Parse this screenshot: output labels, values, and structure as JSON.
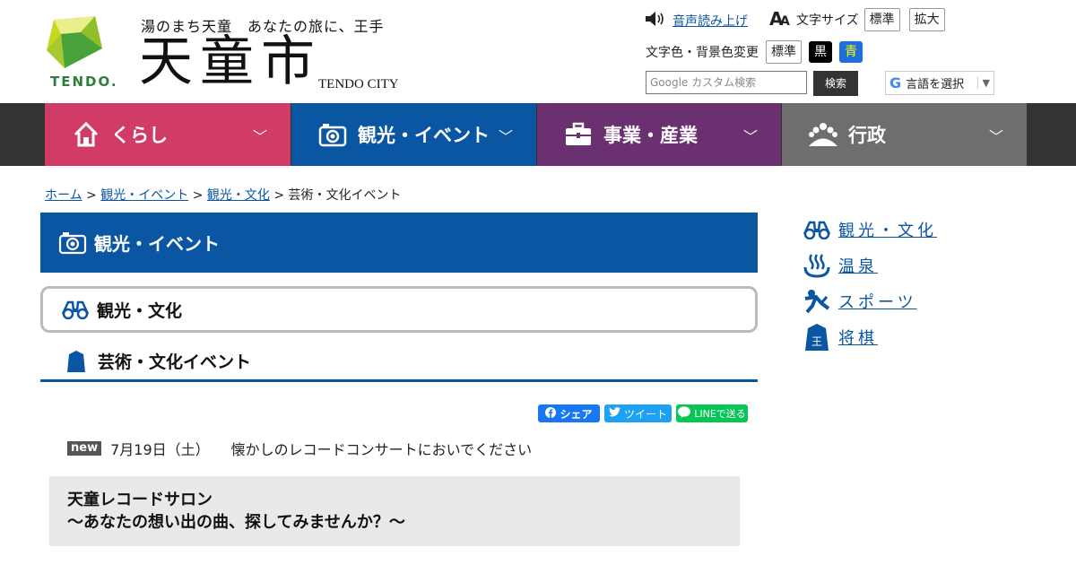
{
  "header": {
    "tagline": "湯のまち天童　あなたの旅に、王手",
    "city_name": "天童市",
    "city_name_en": "TENDO CITY",
    "logo_text": "TENDO.",
    "speech_label": "音声読み上げ",
    "font_size_label": "文字サイズ",
    "font_size_options": [
      "標準",
      "拡大"
    ],
    "color_label": "文字色・背景色変更",
    "color_options": [
      "標準",
      "黒",
      "青"
    ],
    "search_placeholder": "Google カスタム検索",
    "search_button": "検索",
    "language_label": "言語を選択",
    "language_arrow": "▼"
  },
  "nav": {
    "items": [
      {
        "label": "くらし",
        "icon": "house-icon",
        "color": "#d13c66"
      },
      {
        "label": "観光・イベント",
        "icon": "camera-icon",
        "color": "#0a56a3"
      },
      {
        "label": "事業・産業",
        "icon": "briefcase-icon",
        "color": "#6a3070"
      },
      {
        "label": "行政",
        "icon": "people-icon",
        "color": "#6e6e6e"
      }
    ],
    "chevron": "﹀"
  },
  "breadcrumb": {
    "items": [
      "ホーム",
      "観光・イベント",
      "観光・文化",
      "芸術・文化イベント"
    ],
    "separator": ">"
  },
  "section": {
    "title": "観光・イベント",
    "sub_title": "観光・文化",
    "page_title": "芸術・文化イベント"
  },
  "share": {
    "facebook": "シェア",
    "twitter": "ツイート",
    "line": "LINEで送る"
  },
  "news": {
    "badge": "new",
    "date": "7月19日（土）",
    "text": "懐かしのレコードコンサートにおいでください"
  },
  "callout": {
    "line1": "天童レコードサロン",
    "line2": "〜あなたの想い出の曲、探してみませんか？〜"
  },
  "side": {
    "items": [
      {
        "label": "観光・文化",
        "icon": "binoculars-icon"
      },
      {
        "label": "温泉",
        "icon": "hot-spring-icon"
      },
      {
        "label": "スポーツ",
        "icon": "sports-icon"
      },
      {
        "label": "将棋",
        "icon": "shogi-piece-icon"
      }
    ]
  },
  "colors": {
    "primary_blue": "#0a56a3",
    "kurashi_pink": "#d13c66",
    "business_purple": "#6a3070",
    "gyosei_gray": "#6e6e6e"
  }
}
